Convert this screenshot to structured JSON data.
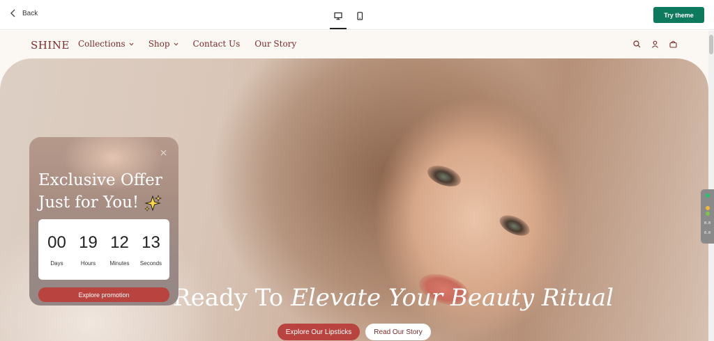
{
  "toolbar": {
    "back_label": "Back",
    "desktop_icon": "desktop-icon",
    "mobile_icon": "mobile-icon",
    "try_theme_label": "Try theme",
    "accent": "#0e7a5d"
  },
  "store": {
    "logo": "SHINE",
    "nav": [
      {
        "label": "Collections",
        "has_dropdown": true
      },
      {
        "label": "Shop",
        "has_dropdown": true
      },
      {
        "label": "Contact Us",
        "has_dropdown": false
      },
      {
        "label": "Our Story",
        "has_dropdown": false
      }
    ],
    "icons": [
      "search-icon",
      "account-icon",
      "cart-icon"
    ],
    "brand_color": "#7a2b2b"
  },
  "hero": {
    "headline_plain": "Ready To",
    "headline_italic": "Elevate Your Beauty Ritual",
    "primary_button": "Explore Our Lipsticks",
    "secondary_button": "Read Our Story",
    "button_color": "#b8433f"
  },
  "popup": {
    "title_line1": "Exclusive Offer",
    "title_line2": "Just for You!",
    "countdown": [
      {
        "value": "00",
        "label": "Days"
      },
      {
        "value": "19",
        "label": "Hours"
      },
      {
        "value": "12",
        "label": "Minutes"
      },
      {
        "value": "13",
        "label": "Seconds"
      }
    ],
    "button_label": "Explore promotion"
  },
  "side_widget": {
    "line1": "0.0",
    "line2": "0.0"
  }
}
